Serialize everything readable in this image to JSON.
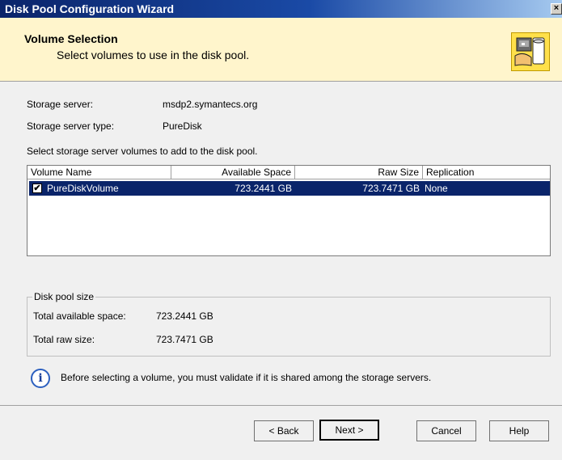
{
  "window": {
    "title": "Disk Pool Configuration Wizard",
    "close_glyph": "×"
  },
  "header": {
    "title": "Volume Selection",
    "subtitle": "Select volumes to use in the disk pool."
  },
  "server": {
    "storage_server_label": "Storage server:",
    "storage_server_value": "msdp2.symantecs.org",
    "type_label": "Storage server type:",
    "type_value": "PureDisk"
  },
  "volumes": {
    "instruction": "Select storage server volumes to add to the disk pool.",
    "columns": [
      "Volume Name",
      "Available Space",
      "Raw Size",
      "Replication"
    ],
    "rows": [
      {
        "checked": true,
        "name": "PureDiskVolume",
        "available": "723.2441 GB",
        "raw": "723.7471 GB",
        "replication": "None"
      }
    ],
    "check_glyph": "✔"
  },
  "pool_size": {
    "legend": "Disk pool size",
    "total_available_label": "Total available space:",
    "total_available_value": "723.2441 GB",
    "total_raw_label": "Total raw size:",
    "total_raw_value": "723.7471 GB"
  },
  "info": {
    "icon_glyph": "i",
    "message": "Before selecting a volume, you must validate if it is shared among the storage servers."
  },
  "buttons": {
    "back": "< Back",
    "next": "Next >",
    "cancel": "Cancel",
    "help": "Help"
  },
  "icons": {
    "wizard": "disk-pool-wizard-icon",
    "info": "info-icon",
    "close": "close-icon",
    "checkbox": "checkbox-icon"
  },
  "colors": {
    "titlebar": "#0a246a",
    "header_bg": "#fff5cc",
    "selection": "#0a246a"
  }
}
